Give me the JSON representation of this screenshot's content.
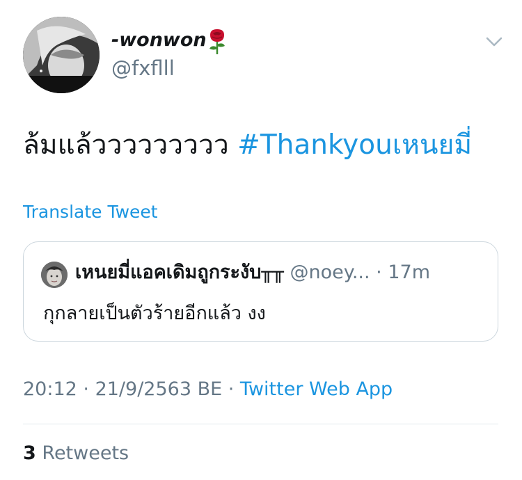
{
  "user": {
    "display_name": "-wonwon",
    "name_emoji_icon": "rose-icon",
    "handle": "@fxflll",
    "avatar_icon": "profile-photo"
  },
  "tweet": {
    "text": "ล้มแล้ววววววววว",
    "hashtag": "#Thankyouเหนยมี่",
    "translate_label": "Translate Tweet"
  },
  "quoted_tweet": {
    "display_name": "เหนยมี่แอคเดิมถูกระงับ╥╥",
    "handle": "@noey...",
    "separator": " · ",
    "time": "17m",
    "text": "กุกลายเป็นตัวร้ายอีกแล้ว งง"
  },
  "meta": {
    "time": "20:12",
    "sep1": " · ",
    "date": "21/9/2563 BE",
    "sep2": " · ",
    "source": "Twitter Web App"
  },
  "stats": {
    "retweet_count": "3",
    "retweet_label": "Retweets"
  },
  "colors": {
    "link": "#1b95e0",
    "secondary_text": "#657786",
    "primary_text": "#14171a",
    "border": "#ccd6dd"
  }
}
